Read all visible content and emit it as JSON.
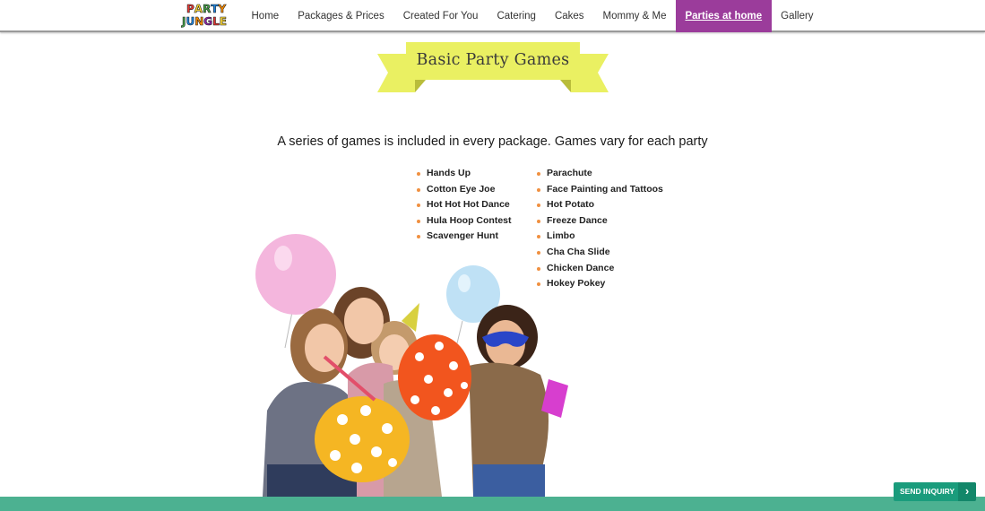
{
  "brand": {
    "logo_line1": [
      "P",
      "A",
      "R",
      "T",
      "Y"
    ],
    "logo_line2": [
      "J",
      "U",
      "N",
      "G",
      "L",
      "E"
    ],
    "logo_colors": [
      "#e53935",
      "#fdd835",
      "#43a047",
      "#1e88e5",
      "#fb8c00",
      "#8e24aa"
    ]
  },
  "nav": {
    "items": [
      {
        "label": "Home"
      },
      {
        "label": "Packages & Prices"
      },
      {
        "label": "Created For You"
      },
      {
        "label": "Catering"
      },
      {
        "label": "Cakes"
      },
      {
        "label": "Mommy & Me"
      },
      {
        "label": "Parties at home"
      },
      {
        "label": "Gallery"
      }
    ],
    "active_label": "Parties at home",
    "active_color": "#9b3c9b"
  },
  "banner": {
    "title": "Basic Party Games",
    "color": "#eaf062"
  },
  "intro": "A series of games is included in every package. Games vary for each party",
  "games": {
    "column1": [
      "Hands Up",
      "Cotton Eye Joe",
      "Hot Hot Hot Dance",
      "Hula Hoop Contest",
      "Scavenger Hunt"
    ],
    "column2": [
      "Parachute",
      "Face Painting and Tattoos",
      "Hot Potato",
      "Freeze Dance",
      "Limbo",
      "Cha Cha Slide",
      "Chicken Dance",
      "Hokey Pokey"
    ],
    "bullet_color": "#f09040"
  },
  "send_inquiry": {
    "label": "SEND INQUIRY",
    "arrow_icon": "chevron-right-icon",
    "color": "#1a9c7c"
  },
  "footer_color": "#4cb191"
}
